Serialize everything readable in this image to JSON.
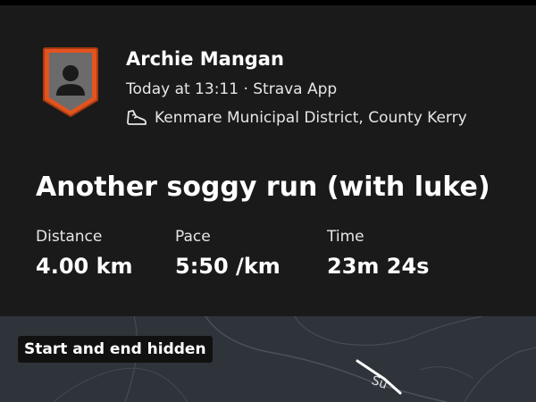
{
  "athlete": {
    "name": "Archie Mangan",
    "meta": "Today at 13:11 · Strava App",
    "location": "Kenmare Municipal District, County Kerry",
    "avatar_icon": "person-icon",
    "location_icon": "running-shoe-icon"
  },
  "activity": {
    "title": "Another soggy run (with luke)"
  },
  "stats": {
    "distance_label": "Distance",
    "distance_value": "4.00 km",
    "pace_label": "Pace",
    "pace_value": "5:50 /km",
    "time_label": "Time",
    "time_value": "23m 24s"
  },
  "map": {
    "badge": "Start and end hidden",
    "street_label": "Su"
  },
  "colors": {
    "card_bg": "#1a1a1a",
    "map_bg": "#2f343a",
    "avatar_orange": "#e2541f"
  }
}
